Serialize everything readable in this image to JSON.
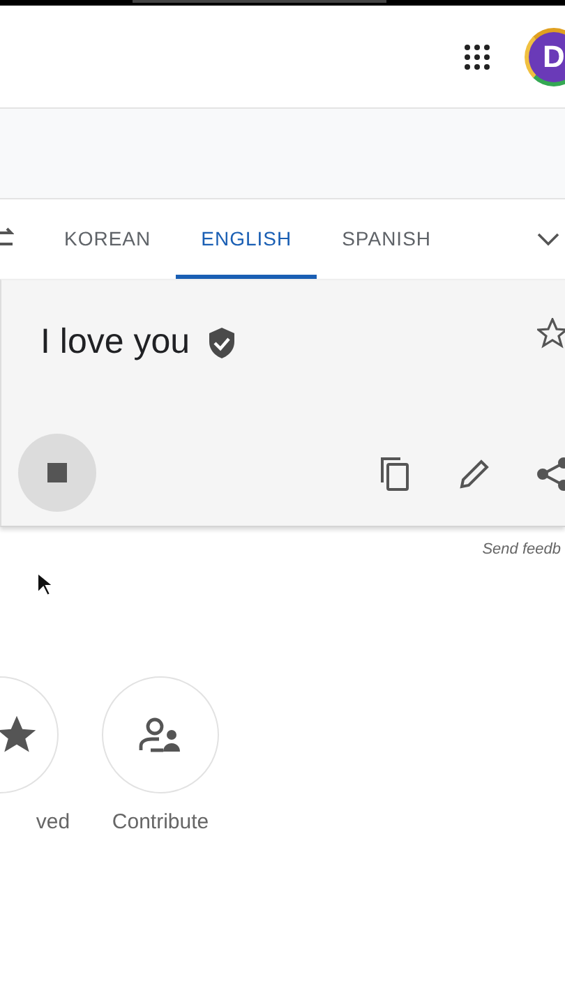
{
  "header": {
    "avatar_letter": "D"
  },
  "language_tabs": [
    {
      "label": "KOREAN",
      "selected": false
    },
    {
      "label": "ENGLISH",
      "selected": true
    },
    {
      "label": "SPANISH",
      "selected": false
    }
  ],
  "translation": {
    "text": "I love you",
    "verified": true,
    "saved": false,
    "playing": true
  },
  "feedback_link": "Send feedb",
  "shortcuts": [
    {
      "label": "ved",
      "kind": "saved"
    },
    {
      "label": "Contribute",
      "kind": "contribute"
    }
  ]
}
